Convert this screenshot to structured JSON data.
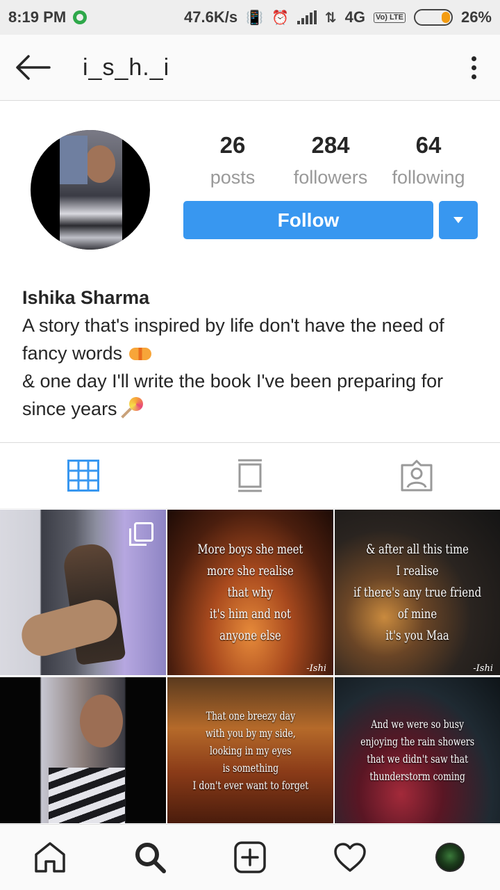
{
  "status_bar": {
    "time": "8:19 PM",
    "speed": "47.6K/s",
    "network": "4G",
    "lte_label": "Vo) LTE",
    "battery": "26%",
    "battery_level": 0.26
  },
  "header": {
    "username": "i_s_h._i"
  },
  "profile": {
    "stats": [
      {
        "count": "26",
        "label": "posts"
      },
      {
        "count": "284",
        "label": "followers"
      },
      {
        "count": "64",
        "label": "following"
      }
    ],
    "follow_label": "Follow",
    "full_name": "Ishika Sharma",
    "bio_line1": "A story that's inspired by life don't have the need of fancy words",
    "bio_line2": "& one day I'll write the book I've been preparing for since years"
  },
  "tabs": [
    {
      "name": "grid-icon",
      "active": true
    },
    {
      "name": "feed-icon",
      "active": false
    },
    {
      "name": "tagged-icon",
      "active": false
    }
  ],
  "posts": [
    {
      "text": ""
    },
    {
      "text": "More boys she meet\nmore she realise\nthat why\nit's him and not\nanyone else",
      "sig": "-Ishi"
    },
    {
      "text": "& after all this time\nI realise\nif there's any true friend\nof mine\nit's you Maa",
      "sig": "-Ishi"
    },
    {
      "text": ""
    },
    {
      "text": "That one breezy day\nwith you by my side,\nlooking in my eyes\nis something\nI don't ever want to forget"
    },
    {
      "text": "And we were so busy\nenjoying the rain showers\nthat we didn't saw that\nthunderstorm coming"
    }
  ],
  "colors": {
    "accent": "#3897f0",
    "status_green": "#2ea84a",
    "battery": "#f39c12"
  },
  "icons": {
    "back": "arrow-left-icon",
    "more": "more-vertical-icon",
    "home": "home-icon",
    "search": "search-icon",
    "add": "add-post-icon",
    "activity": "heart-icon",
    "profile": "profile-avatar"
  }
}
